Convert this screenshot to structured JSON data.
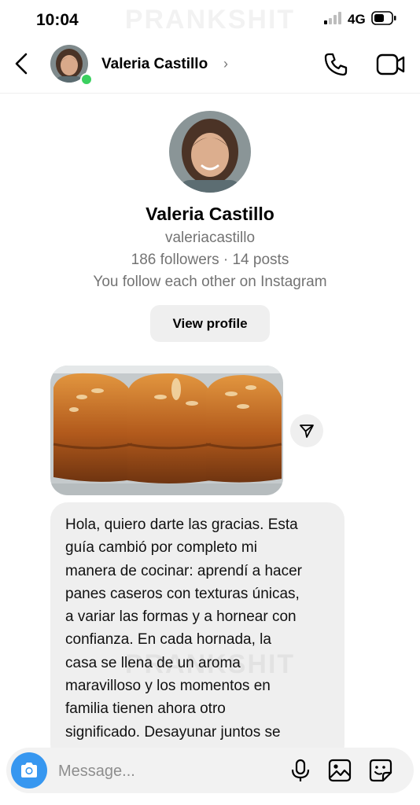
{
  "status_bar": {
    "time": "10:04",
    "network": "4G",
    "watermark": "PRANKSHIT"
  },
  "header": {
    "contact_name": "Valeria Castillo",
    "chevron": "›",
    "icons": [
      "back-arrow-icon",
      "avatar",
      "online-status-dot",
      "phone-icon",
      "video-camera-icon"
    ]
  },
  "profile": {
    "name": "Valeria Castillo",
    "username": "valeriacastillo",
    "stats": "186 followers · 14 posts",
    "mutual": "You follow each other on Instagram",
    "view_profile_label": "View profile"
  },
  "messages": [
    {
      "type": "photo",
      "content": "photo of golden braided bread loaves in a baking tray",
      "action_icon": "share-send-icon"
    },
    {
      "type": "text",
      "lines": [
        "Hola, quiero darte las gracias. Esta",
        "guía cambió por completo mi",
        "manera de cocinar: aprendí a hacer",
        "panes caseros con texturas únicas,",
        "a variar las formas y a hornear con",
        "confianza. En cada hornada, la",
        "casa se llena de un aroma",
        "maravilloso y los momentos en",
        "familia tienen ahora otro",
        "significado. Desayunar juntos se"
      ]
    }
  ],
  "composer": {
    "placeholder": "Message...",
    "icons": [
      "camera-icon",
      "microphone-icon",
      "gallery-icon",
      "sticker-icon"
    ]
  },
  "colors": {
    "accent_blue": "#3797f0",
    "online_green": "#3ad05f",
    "bubble_gray": "#efefef",
    "secondary_text": "#737373"
  }
}
